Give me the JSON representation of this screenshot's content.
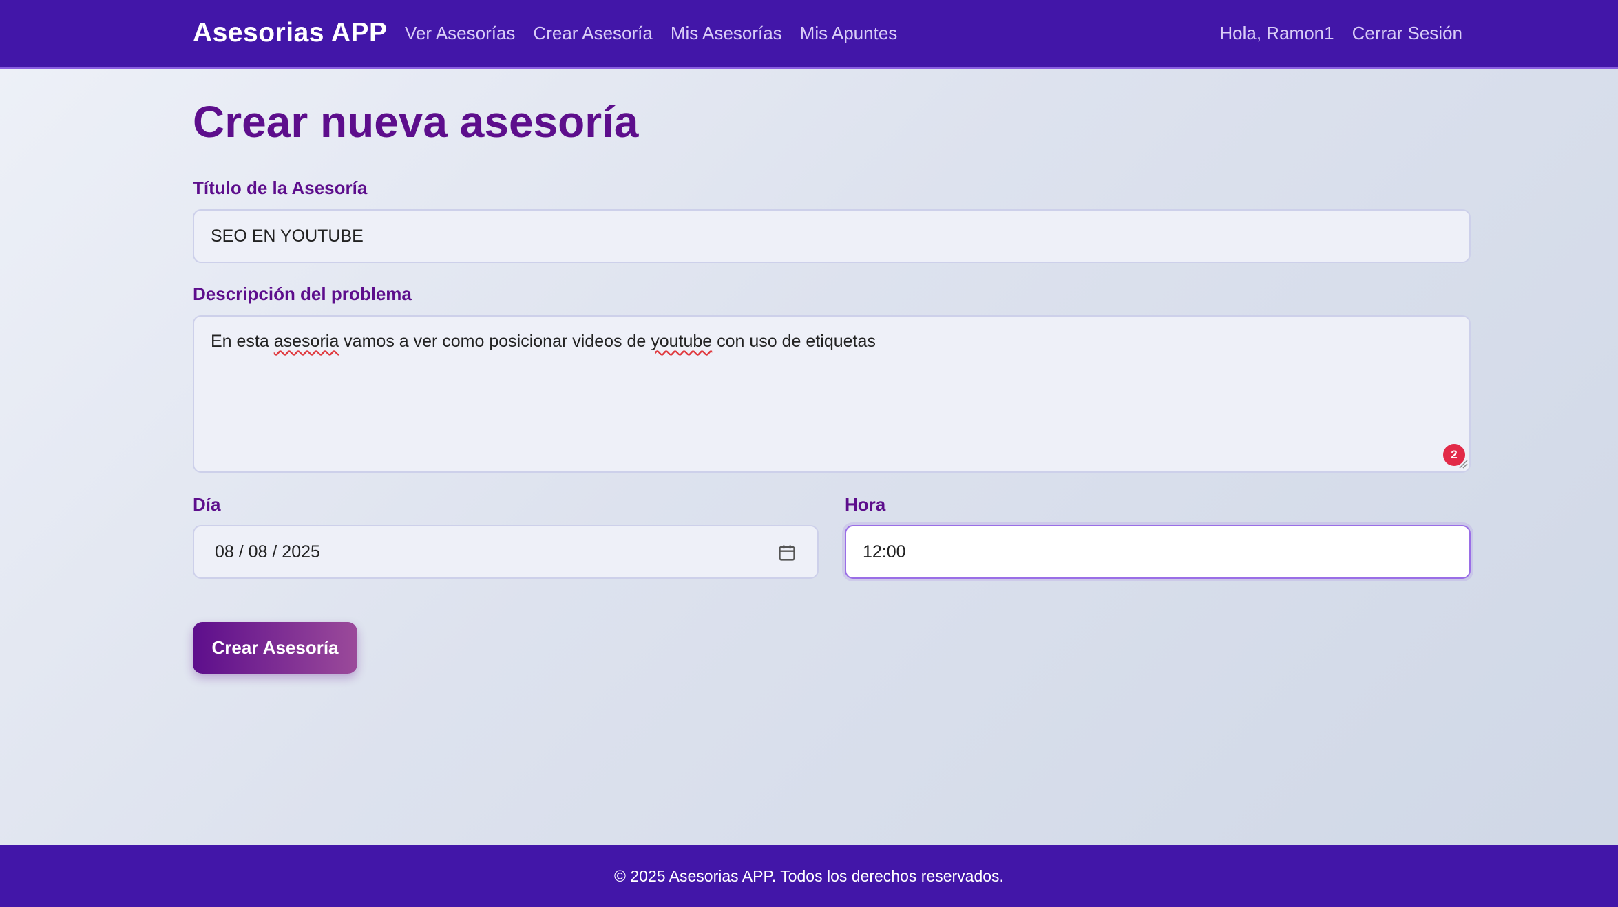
{
  "navbar": {
    "brand": "Asesorias APP",
    "links": [
      "Ver Asesorías",
      "Crear Asesoría",
      "Mis Asesorías",
      "Mis Apuntes"
    ],
    "greeting": "Hola, Ramon1",
    "logout": "Cerrar Sesión"
  },
  "form": {
    "page_title": "Crear nueva asesoría",
    "title_label": "Título de la Asesoría",
    "title_value": "SEO EN YOUTUBE",
    "description_label": "Descripción del problema",
    "description_parts": [
      "En esta ",
      "asesoria",
      " vamos a ver como posicionar videos de ",
      "youtube",
      " con uso de etiquetas"
    ],
    "description_badge": "2",
    "day_label": "Día",
    "day_value": "08 / 08 / 2025",
    "hour_label": "Hora",
    "hour_value": "12:00",
    "submit_label": "Crear Asesoría"
  },
  "footer": {
    "text": "© 2025 Asesorias APP. Todos los derechos reservados."
  },
  "colors": {
    "navbar": "#4216a8",
    "accent": "#5d0e8c",
    "badge": "#e22a48"
  },
  "icons": [
    "calendar-icon",
    "resize-grip-icon"
  ]
}
